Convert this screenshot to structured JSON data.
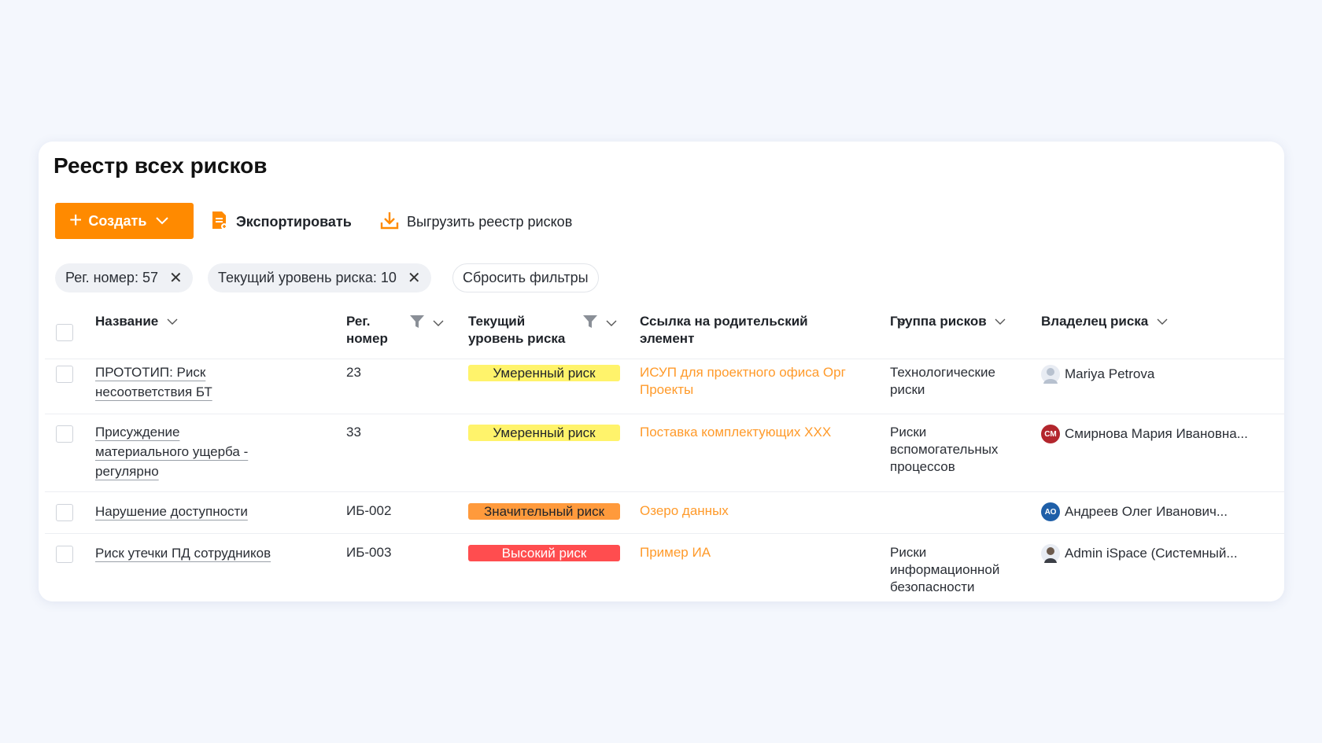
{
  "page": {
    "title": "Реестр всех рисков"
  },
  "toolbar": {
    "create_label": "Создать",
    "export_label": "Экспортировать",
    "download_label": "Выгрузить реестр рисков"
  },
  "filters": {
    "chips": [
      "Рег. номер: 57",
      "Текущий уровень риска: 10"
    ],
    "reset_label": "Сбросить фильтры"
  },
  "table": {
    "headers": {
      "name": "Название",
      "reg_line1": "Рег.",
      "reg_line2": "номер",
      "level_line1": "Текущий",
      "level_line2": "уровень риска",
      "parent_line1": "Ссылка на родительский",
      "parent_line2": "элемент",
      "group": "Группа рисков",
      "owner": "Владелец риска"
    },
    "rows": [
      {
        "name_lines": [
          "ПРОТОТИП: Риск",
          "несоответствия БТ"
        ],
        "reg": "23",
        "level": "Умеренный риск",
        "parent_lines": [
          "ИСУП для проектного офиса Орг",
          "Проекты"
        ],
        "group_lines": [
          "Технологические",
          "риски"
        ],
        "owner": "Mariya Petrova",
        "owner_initials": ""
      },
      {
        "name_lines": [
          "Присуждение",
          "материального ущерба -",
          "регулярно"
        ],
        "reg": "33",
        "level": "Умеренный риск",
        "parent_lines": [
          "Поставка комплектующих ХХХ"
        ],
        "group_lines": [
          "Риски",
          "вспомогательных",
          "процессов"
        ],
        "owner": "Смирнова Мария Ивановна...",
        "owner_initials": "СМ"
      },
      {
        "name_lines": [
          "Нарушение доступности"
        ],
        "reg": "ИБ-002",
        "level": "Значительный риск",
        "parent_lines": [
          "Озеро данных"
        ],
        "group_lines": [],
        "owner": "Андреев Олег Иванович...",
        "owner_initials": "АО"
      },
      {
        "name_lines": [
          "Риск утечки ПД сотрудников"
        ],
        "reg": "ИБ-003",
        "level": "Высокий риск",
        "parent_lines": [
          "Пример ИА"
        ],
        "group_lines": [
          "Риски",
          "информационной",
          "безопасности"
        ],
        "owner": "Admin iSpace (Системный...",
        "owner_initials": ""
      }
    ]
  },
  "colors": {
    "accent": "#ff8a00",
    "link": "#ff9a2a",
    "moderate": "#fff36b",
    "significant": "#ff9a3c",
    "high": "#ff4d4f",
    "avatar_sm": "#b3262d",
    "avatar_ao": "#1f5fa8"
  }
}
